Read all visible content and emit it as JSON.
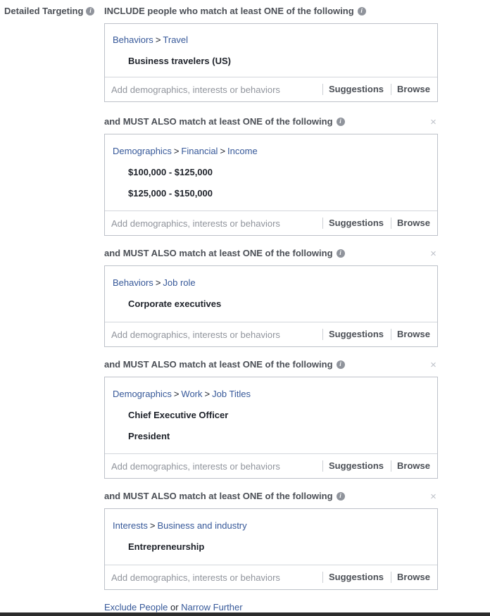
{
  "section_label": "Detailed Targeting",
  "include_heading": "INCLUDE people who match at least ONE of the following",
  "and_heading": "and MUST ALSO match at least ONE of the following",
  "close_glyph": "×",
  "input_placeholder": "Add demographics, interests or behaviors",
  "suggestions_label": "Suggestions",
  "browse_label": "Browse",
  "breadcrumb_separator": ">",
  "groups": [
    {
      "path": [
        "Behaviors",
        "Travel"
      ],
      "items": [
        "Business travelers (US)"
      ]
    },
    {
      "path": [
        "Demographics",
        "Financial",
        "Income"
      ],
      "items": [
        "$100,000 - $125,000",
        "$125,000 - $150,000"
      ]
    },
    {
      "path": [
        "Behaviors",
        "Job role"
      ],
      "items": [
        "Corporate executives"
      ]
    },
    {
      "path": [
        "Demographics",
        "Work",
        "Job Titles"
      ],
      "items": [
        "Chief Executive Officer",
        "President"
      ]
    },
    {
      "path": [
        "Interests",
        "Business and industry"
      ],
      "items": [
        "Entrepreneurship"
      ]
    }
  ],
  "footer": {
    "exclude_label": "Exclude People",
    "or_text": "or",
    "narrow_label": "Narrow Further"
  },
  "colors": {
    "link": "#365899",
    "border": "#bdc1c9",
    "muted": "#90949c",
    "heading": "#4b4f56"
  }
}
